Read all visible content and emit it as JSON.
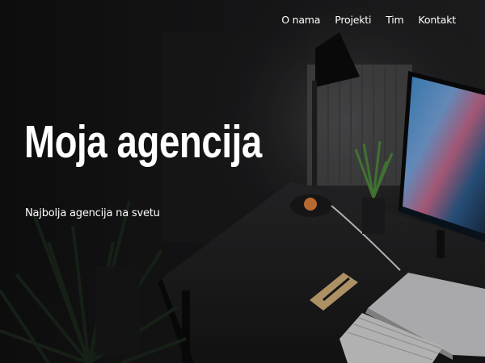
{
  "nav": {
    "items": [
      {
        "label": "O nama"
      },
      {
        "label": "Projekti"
      },
      {
        "label": "Tim"
      },
      {
        "label": "Kontakt"
      }
    ]
  },
  "hero": {
    "title": "Moja agencija",
    "subtitle": "Najbolja agencija na svetu"
  },
  "colors": {
    "background": "#0e0e0f",
    "text": "#ffffff"
  }
}
